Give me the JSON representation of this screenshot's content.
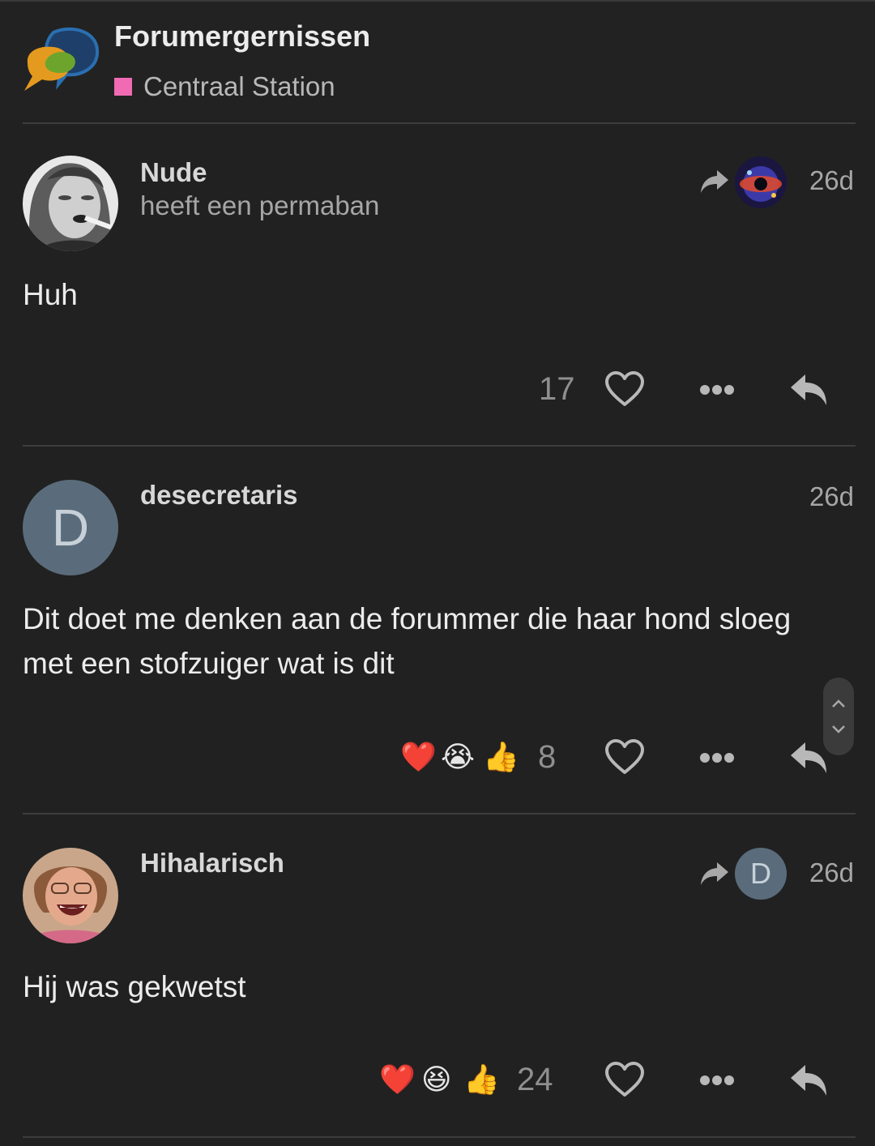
{
  "header": {
    "site_title": "Forumergernissen",
    "category": "Centraal Station",
    "category_color": "#f06bb3"
  },
  "posts": [
    {
      "username": "Nude",
      "user_title": "heeft een permaban",
      "avatar": "woman-with-cigarette-photo",
      "reply_to_avatar": "galaxy-image",
      "time": "26d",
      "body": "Huh",
      "reactions": [],
      "like_count": "17"
    },
    {
      "username": "desecretaris",
      "avatar_letter": "D",
      "time": "26d",
      "body": "Dit doet me denken aan de forummer die haar hond sloeg met een stofzuiger wat is dit",
      "reactions": [
        "❤️",
        "😭",
        "👍"
      ],
      "like_count": "8"
    },
    {
      "username": "Hihalarisch",
      "avatar": "laughing-woman-photo",
      "reply_to_letter": "D",
      "time": "26d",
      "body": "Hij was gekwetst",
      "reactions": [
        "❤️",
        "😆",
        "👍"
      ],
      "like_count": "24"
    }
  ]
}
